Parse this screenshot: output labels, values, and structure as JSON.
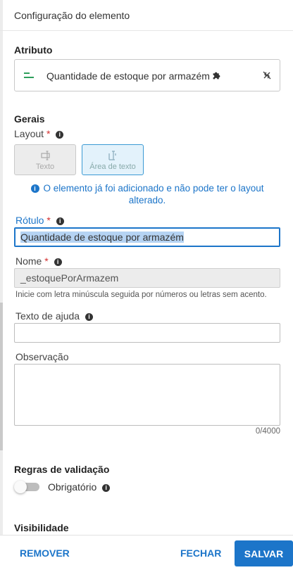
{
  "header": {
    "title": "Configuração do elemento"
  },
  "attribute": {
    "section_label": "Atributo",
    "name": "Quantidade de estoque por armazém",
    "type_icon": "text-lines-icon",
    "plugin_icon": "puzzle-icon",
    "action_icon": "unlink-icon"
  },
  "general": {
    "section_label": "Gerais",
    "layout_label": "Layout",
    "required_mark": "*",
    "layout_options": [
      {
        "label": "Texto",
        "icon": "text-field-icon",
        "selected": false,
        "disabled": true
      },
      {
        "label": "Área de texto",
        "icon": "text-area-icon",
        "selected": true,
        "disabled": true
      }
    ],
    "layout_notice": "O elemento já foi adicionado e não pode ter o layout alterado."
  },
  "fields": {
    "label": {
      "label": "Rótulo",
      "value": "Quantidade de estoque por armazém",
      "required": true
    },
    "name": {
      "label": "Nome",
      "value": "_estoquePorArmazem",
      "required": true,
      "helper": "Inicie com letra minúscula seguida por números ou letras sem acento."
    },
    "help_text": {
      "label": "Texto de ajuda",
      "value": ""
    },
    "observation": {
      "label": "Observação",
      "value": "",
      "counter": "0/4000"
    }
  },
  "validation": {
    "section_label": "Regras de validação",
    "required_toggle_label": "Obrigatório",
    "required_on": false
  },
  "visibility": {
    "section_label": "Visibilidade"
  },
  "footer": {
    "remove_label": "REMOVER",
    "close_label": "FECHAR",
    "save_label": "SALVAR"
  },
  "colors": {
    "primary": "#1c75c9",
    "required": "#d32f2f",
    "attribute_icon": "#2e9e5b"
  }
}
